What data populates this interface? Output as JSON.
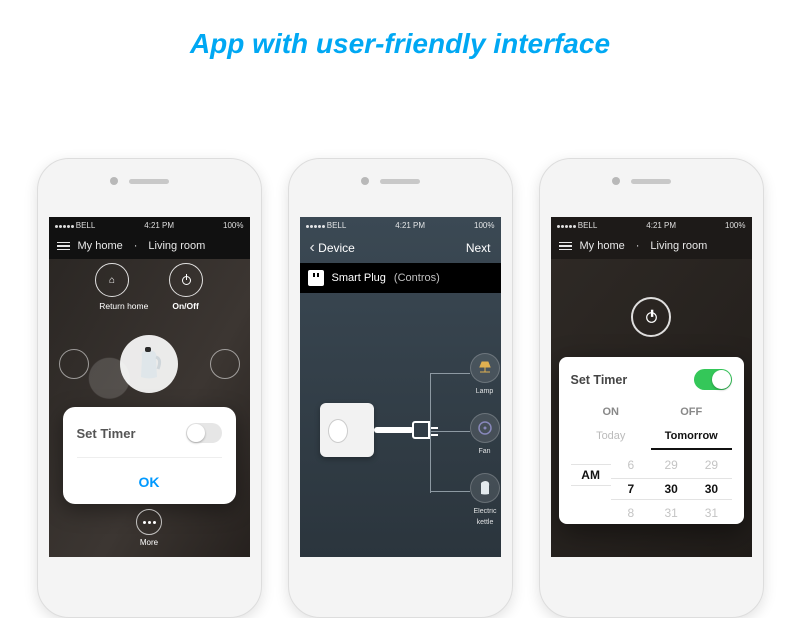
{
  "headline": "App with user-friendly interface",
  "status": {
    "carrier": "BELL",
    "time": "4:21 PM",
    "battery": "100%"
  },
  "phone1": {
    "location_a": "My home",
    "location_b": "Living room",
    "btn_return": "Return home",
    "btn_onoff": "On/Off",
    "more": "More",
    "popup": {
      "title": "Set Timer",
      "confirm": "OK"
    }
  },
  "phone2": {
    "back": "Device",
    "next": "Next",
    "device_name": "Smart Plug",
    "device_brand": "(Contros)",
    "dev1": "Lamp",
    "dev2": "Fan",
    "dev3": "Electric kettle"
  },
  "phone3": {
    "location_a": "My home",
    "location_b": "Living room",
    "panel_title": "Set Timer",
    "on_label": "ON",
    "off_label": "OFF",
    "today": "Today",
    "tomorrow": "Tomorrow",
    "wheel": {
      "c1": [
        "",
        "AM",
        ""
      ],
      "c2": [
        "6",
        "7",
        "8"
      ],
      "c3": [
        "29",
        "30",
        "31"
      ],
      "c4": [
        "29",
        "30",
        "31"
      ]
    }
  }
}
